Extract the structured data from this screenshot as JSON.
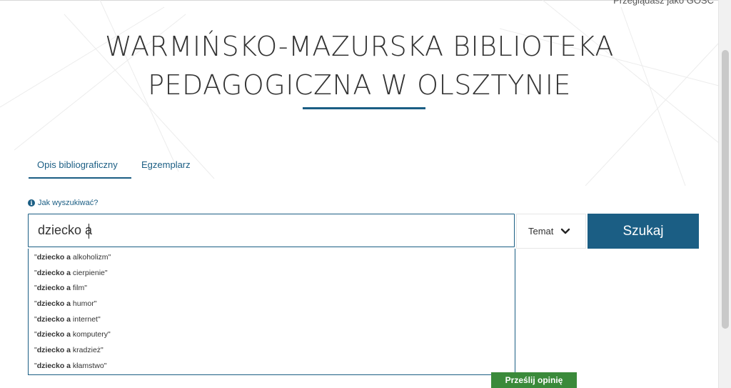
{
  "header": {
    "guest_text": "Przeglądasz jako GOŚĆ",
    "title_line1": "WARMIŃSKO-MAZURSKA BIBLIOTEKA",
    "title_line2": "PEDAGOGICZNA W OLSZTYNIE"
  },
  "tabs": [
    {
      "label": "Opis bibliograficzny",
      "active": true
    },
    {
      "label": "Egzemplarz",
      "active": false
    }
  ],
  "help": {
    "icon": "info-icon",
    "label": "Jak wyszukiwać?"
  },
  "search": {
    "value": "dziecko a",
    "scope": "Temat",
    "scope_icon": "chevron-down-icon",
    "button": "Szukaj",
    "suggestions": [
      {
        "bold": "dziecko a",
        "rest": " alkoholizm"
      },
      {
        "bold": "dziecko a",
        "rest": " cierpienie"
      },
      {
        "bold": "dziecko a",
        "rest": " film"
      },
      {
        "bold": "dziecko a",
        "rest": " humor"
      },
      {
        "bold": "dziecko a",
        "rest": " internet"
      },
      {
        "bold": "dziecko a",
        "rest": " komputery"
      },
      {
        "bold": "dziecko a",
        "rest": " kradzież"
      },
      {
        "bold": "dziecko a",
        "rest": " kłamstwo"
      }
    ]
  },
  "feedback_button": "Prześlij opinię",
  "colors": {
    "accent": "#1b5e84",
    "feedback": "#3a8a3a"
  }
}
